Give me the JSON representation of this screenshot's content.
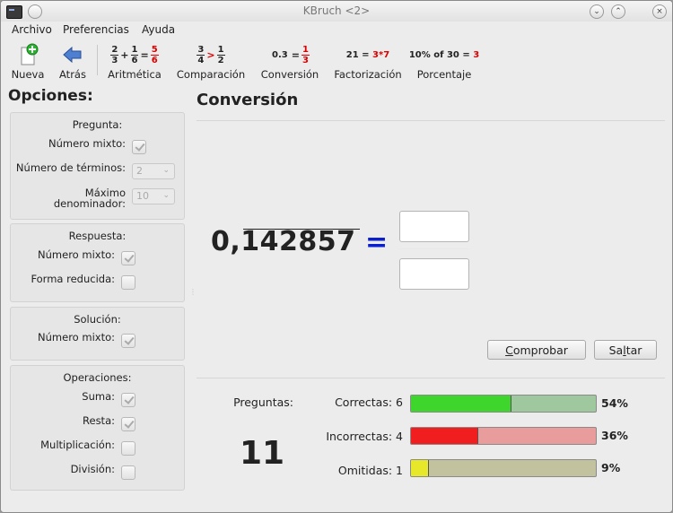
{
  "window": {
    "title": "KBruch <2>"
  },
  "menu": [
    {
      "label": "Archivo"
    },
    {
      "label": "Preferencias"
    },
    {
      "label": "Ayuda"
    }
  ],
  "toolbar": {
    "new_label": "Nueva",
    "back_label": "Atrás",
    "arith": {
      "label": "Aritmética",
      "a_num": "2",
      "a_den": "3",
      "op": "+",
      "b_num": "1",
      "b_den": "6",
      "eq": "=",
      "r_num": "5",
      "r_den": "6"
    },
    "compare": {
      "label": "Comparación",
      "a_num": "3",
      "a_den": "4",
      "op": ">",
      "b_num": "1",
      "b_den": "2"
    },
    "convert": {
      "label": "Conversión",
      "dec": "0.3",
      "eq": "=",
      "r_num": "1",
      "r_den": "3"
    },
    "factor": {
      "label": "Factorización",
      "lhs": "21 = ",
      "rhs": "3*7"
    },
    "percent": {
      "label": "Porcentaje",
      "lhs": "10% of 30 = ",
      "rhs": "3"
    }
  },
  "options": {
    "title": "Opciones:",
    "pregunta": {
      "title": "Pregunta:",
      "mixed_label": "Número mixto:",
      "terms_label": "Número de términos:",
      "terms_value": "2",
      "maxden_label_1": "Máximo",
      "maxden_label_2": "denominador:",
      "maxden_value": "10"
    },
    "respuesta": {
      "title": "Respuesta:",
      "mixed_label": "Número mixto:",
      "reduced_label": "Forma reducida:"
    },
    "solucion": {
      "title": "Solución:",
      "mixed_label": "Número mixto:"
    },
    "operaciones": {
      "title": "Operaciones:",
      "sum_label": "Suma:",
      "sub_label": "Resta:",
      "mul_label": "Multiplicación:",
      "div_label": "División:"
    }
  },
  "exercise": {
    "title": "Conversión",
    "integer_part": "0,",
    "periodic_part": "142857",
    "equals": "=",
    "check_button": "Comprobar",
    "check_mnemonic": "C",
    "check_rest": "omprobar",
    "skip_button": "Saltar",
    "skip_pre": "Sa",
    "skip_mnemonic": "l",
    "skip_rest": "tar"
  },
  "stats": {
    "questions_label": "Preguntas:",
    "questions_count": "11",
    "correct_label": "Correctas: 6",
    "correct_pct": "54%",
    "correct_fraction": 0.54,
    "incorrect_label": "Incorrectas: 4",
    "incorrect_pct": "36%",
    "incorrect_fraction": 0.36,
    "skipped_label": "Omitidas: 1",
    "skipped_pct": "9%",
    "skipped_fraction": 0.09,
    "colors": {
      "correct_fill": "#3ed52c",
      "correct_bg": "#9fc89f",
      "incorrect_fill": "#f01e1e",
      "incorrect_bg": "#e89c9c",
      "skipped_fill": "#e8e82a",
      "skipped_bg": "#c2c29e"
    }
  }
}
